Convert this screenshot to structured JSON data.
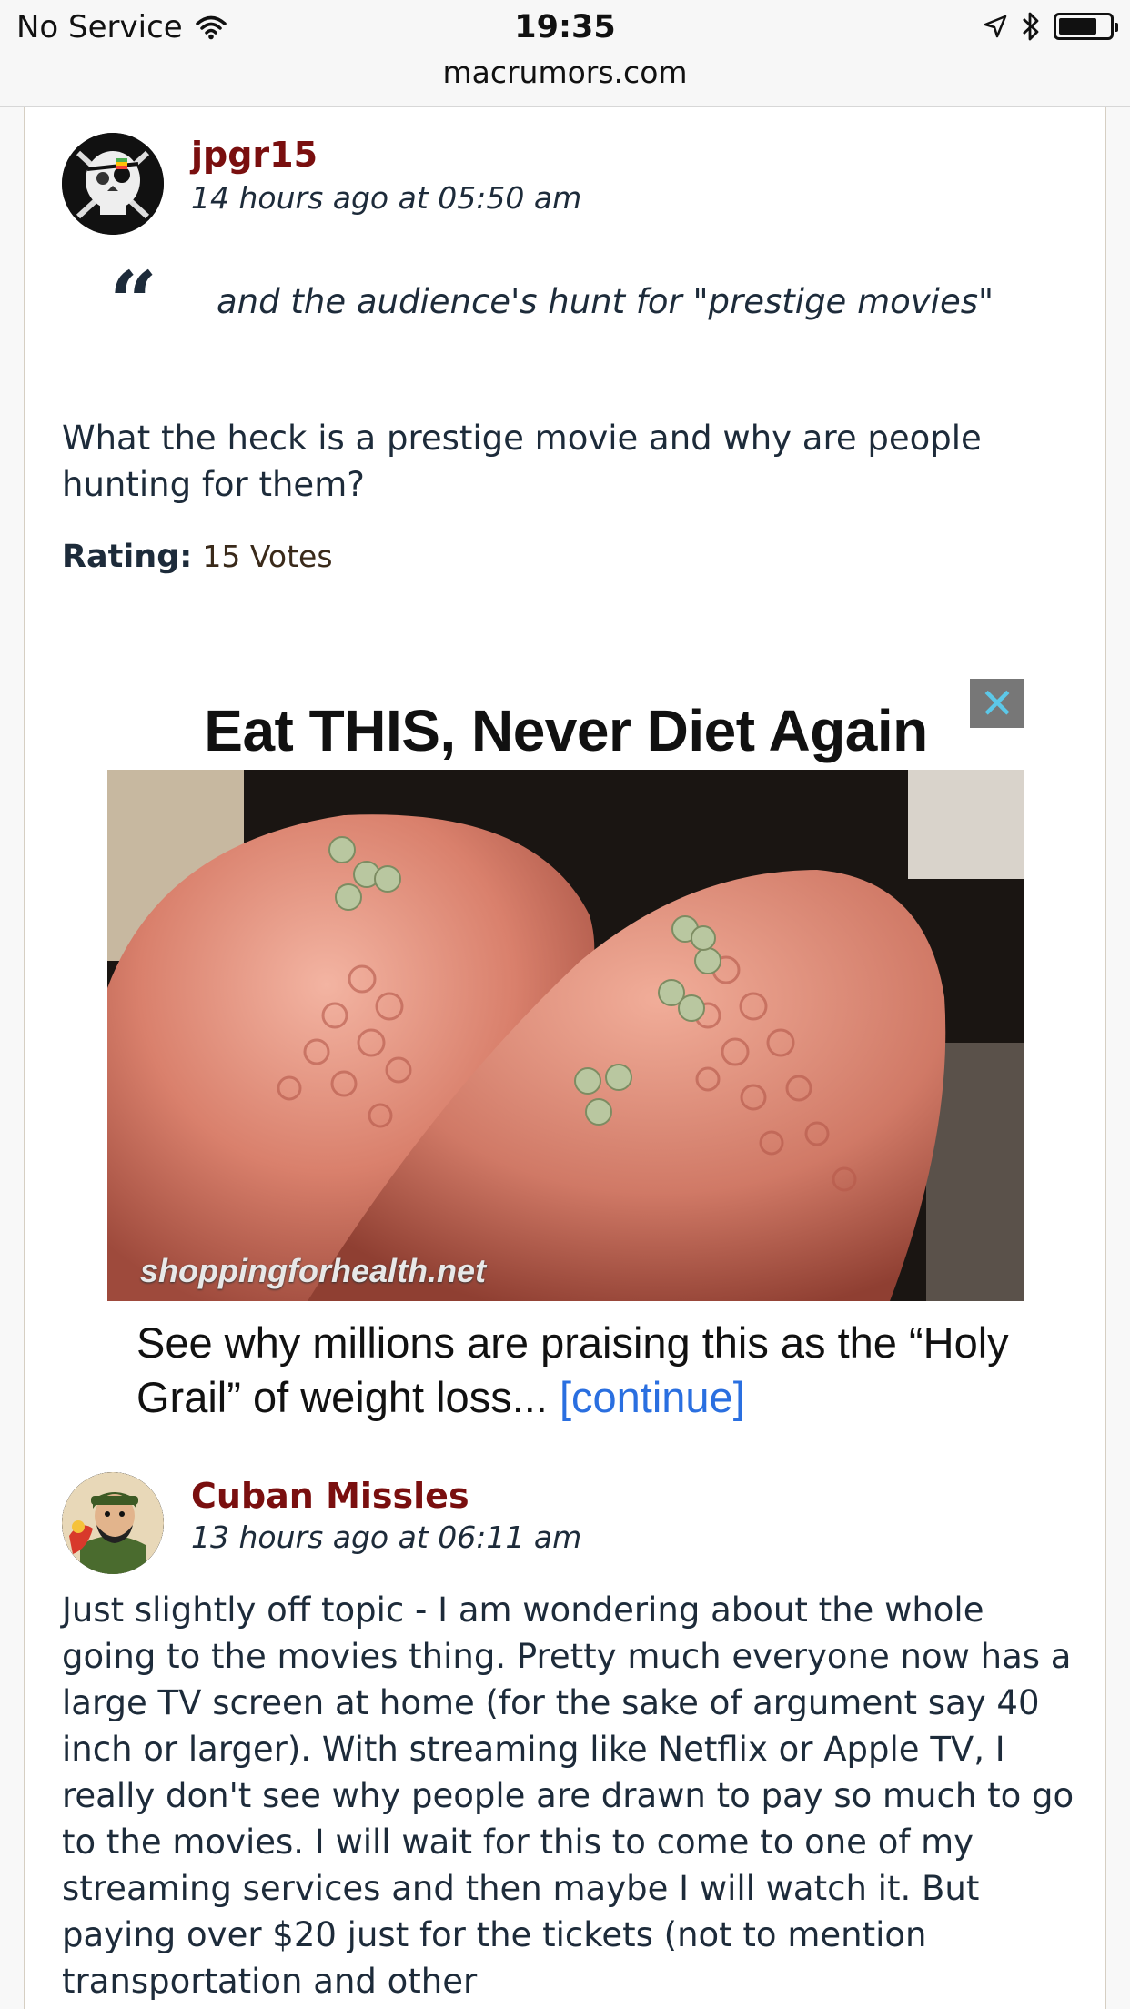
{
  "status_bar": {
    "carrier": "No Service",
    "time": "19:35",
    "url": "macrumors.com",
    "battery_level": 0.75
  },
  "posts": [
    {
      "author": "jpgr15",
      "timestamp": "14 hours ago at 05:50 am",
      "quote": "and the audience's hunt for \"prestige movies\"",
      "body": "What the heck is a prestige movie and why are people hunting for them?",
      "rating_label": "Rating:",
      "rating_value": "15 Votes"
    },
    {
      "author": "Cuban Missles",
      "timestamp": "13 hours ago at 06:11 am",
      "body": "Just slightly off topic - I am wondering about the whole going to the movies thing. Pretty much everyone now has a large TV screen at home (for the sake of argument say 40 inch or larger). With streaming like Netflix or Apple TV, I really don't see why people are drawn to pay so much to go to the movies. I will wait for this to come to one of my streaming services and then maybe I will watch it. But paying over $20 just for the tickets (not to mention transportation and other"
    }
  ],
  "ad": {
    "title": "Eat THIS, Never Diet Again",
    "domain": "shoppingforhealth.net",
    "caption": "See why millions are praising this as the “Holy Grail” of weight loss...",
    "continue_label": "[continue]",
    "close_icon": "close-icon"
  },
  "colors": {
    "author": "#7a0f0f",
    "text": "#1d2b3a",
    "link": "#2a6fe0"
  }
}
